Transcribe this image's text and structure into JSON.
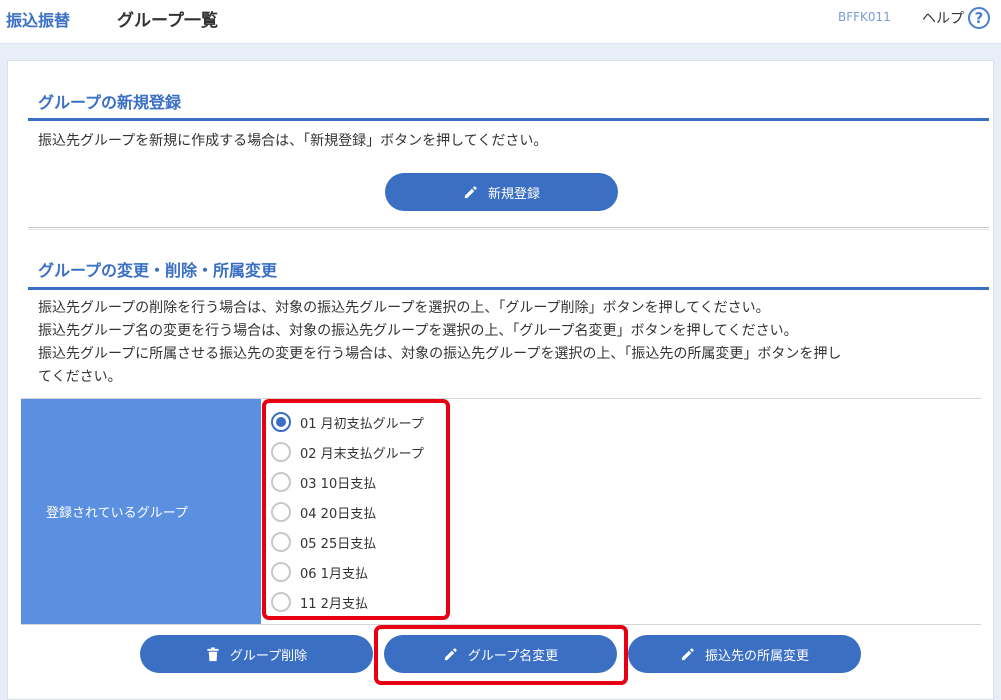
{
  "header": {
    "brand": "振込振替",
    "title": "グループ一覧",
    "screen_id": "BFFK011",
    "help_label": "ヘルプ",
    "help_glyph": "?"
  },
  "new_group": {
    "heading": "グループの新規登録",
    "description": "振込先グループを新規に作成する場合は、「新規登録」ボタンを押してください。",
    "button_label": "新規登録"
  },
  "modify_group": {
    "heading": "グループの変更・削除・所属変更",
    "description_lines": [
      "振込先グループの削除を行う場合は、対象の振込先グループを選択の上、「グループ削除」ボタンを押してください。",
      "振込先グループ名の変更を行う場合は、対象の振込先グループを選択の上、「グループ名変更」ボタンを押してください。",
      "振込先グループに所属させる振込先の変更を行う場合は、対象の振込先グループを選択の上、「振込先の所属変更」ボタンを押し",
      "てください。"
    ],
    "table_label": "登録されているグループ",
    "groups": [
      {
        "label": "01 月初支払グループ",
        "selected": true
      },
      {
        "label": "02 月末支払グループ",
        "selected": false
      },
      {
        "label": "03 10日支払",
        "selected": false
      },
      {
        "label": "04 20日支払",
        "selected": false
      },
      {
        "label": "05 25日支払",
        "selected": false
      },
      {
        "label": "06 1月支払",
        "selected": false
      },
      {
        "label": "11 2月支払",
        "selected": false
      }
    ],
    "buttons": {
      "delete": "グループ削除",
      "rename": "グループ名変更",
      "change_membership": "振込先の所属変更"
    }
  },
  "colors": {
    "accent": "#3a6fc4",
    "label_bg": "#5b8fe0",
    "highlight": "#e60012"
  }
}
